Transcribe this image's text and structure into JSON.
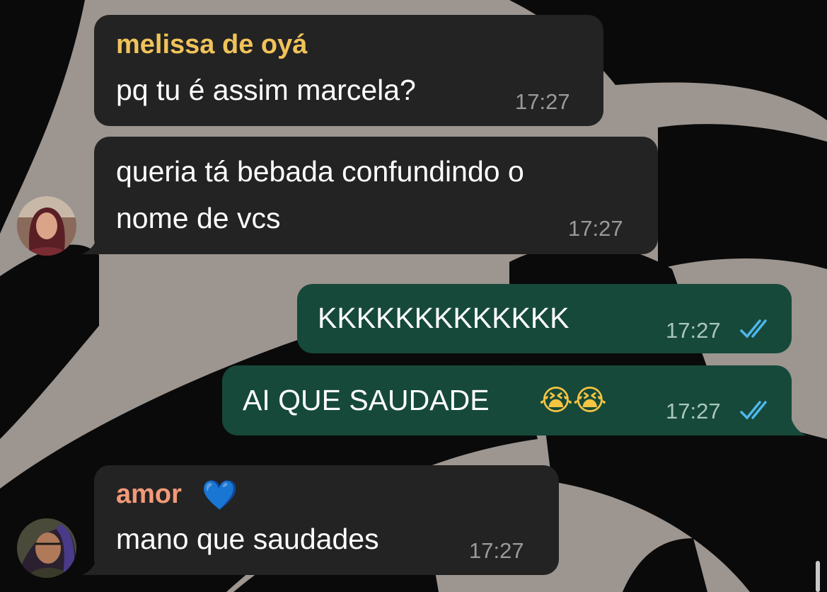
{
  "colors": {
    "incoming_bubble": "#232323",
    "outgoing_bubble": "#16493a",
    "read_ticks": "#4fb6ec",
    "sender_melissa": "#f0c35a",
    "sender_amor": "#f29a78"
  },
  "messages": [
    {
      "sender": "melissa de oyá",
      "text": "pq tu é assim marcela?",
      "time": "17:27"
    },
    {
      "text_line1": "queria tá bebada confundindo o",
      "text_line2": "nome de vcs",
      "time": "17:27"
    },
    {
      "text": "KKKKKKKKKKKKK",
      "time": "17:27",
      "status_icon": "double-check-icon"
    },
    {
      "text": "AI QUE SAUDADE",
      "emoji": "😭😭",
      "time": "17:27",
      "status_icon": "double-check-icon"
    },
    {
      "sender": "amor",
      "sender_emoji": "💙",
      "text": "mano que saudades",
      "time": "17:27"
    }
  ]
}
